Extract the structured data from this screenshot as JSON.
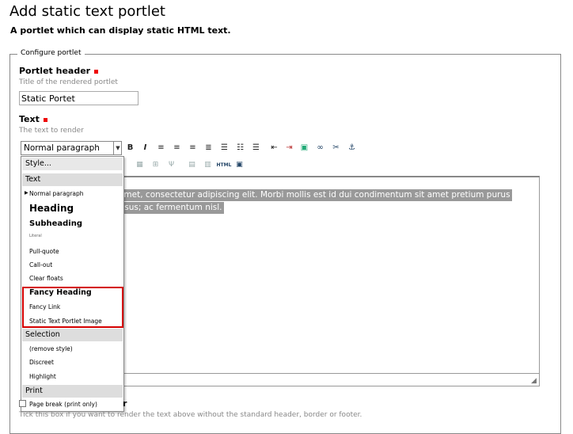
{
  "page": {
    "title": "Add static text portlet",
    "description": "A portlet which can display static HTML text."
  },
  "fieldset": {
    "legend": "Configure portlet"
  },
  "portlet_header": {
    "label": "Portlet header",
    "help": "Title of the rendered portlet",
    "value": "Static Portet"
  },
  "text_field": {
    "label": "Text",
    "help": "The text to render"
  },
  "toolbar": {
    "style_select_value": "Normal paragraph",
    "bold": "B",
    "italic": "I",
    "html_label": "HTML"
  },
  "editor": {
    "line1": "amet, consectetur adipiscing elit. Morbi mollis est id dui condimentum sit amet pretium purus",
    "line2": "risus; ac fermentum nisl."
  },
  "style_dropdown": {
    "header": "Style...",
    "groups": [
      {
        "label": "Text",
        "items": [
          "Normal paragraph",
          "Heading",
          "Subheading",
          "Literal",
          "Pull-quote",
          "Call-out",
          "Clear floats",
          "Fancy Heading",
          "Fancy Link",
          "Static Text Portlet Image"
        ]
      },
      {
        "label": "Selection",
        "items": [
          "(remove style)",
          "Discreet",
          "Highlight"
        ]
      },
      {
        "label": "Print",
        "items": [
          "Page break (print only)"
        ]
      }
    ]
  },
  "omit_border": {
    "label_tail": "r",
    "help": "Tick this box if you want to render the text above without the standard header, border or footer."
  },
  "colors": {
    "required": "#ee0000",
    "highlight_box": "#d40000",
    "selection_bg": "#999999"
  }
}
